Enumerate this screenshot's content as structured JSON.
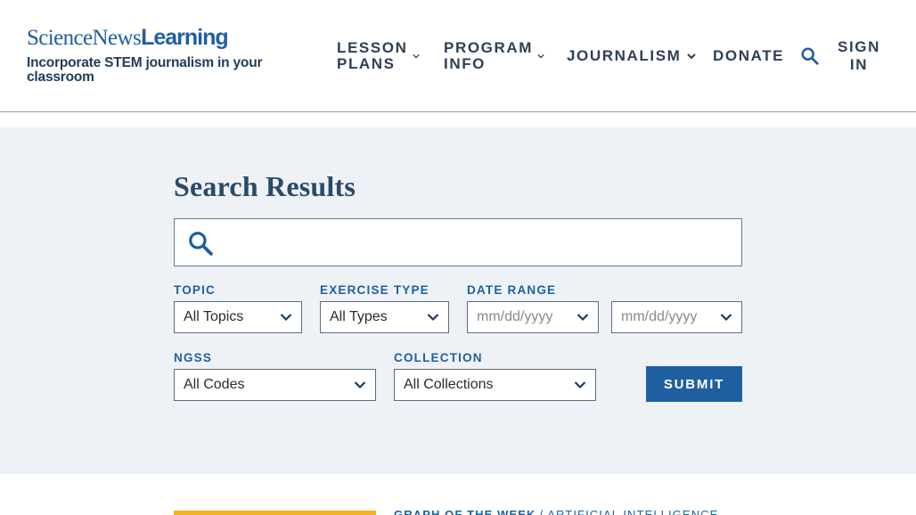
{
  "header": {
    "logo": {
      "science_news": "ScienceNews",
      "learning": "Learning"
    },
    "tagline": "Incorporate STEM journalism in your classroom",
    "nav": {
      "lesson_plans": "LESSON PLANS",
      "program_info": "PROGRAM INFO",
      "journalism": "JOURNALISM",
      "donate": "DONATE",
      "sign_in": "SIGN IN"
    },
    "icons": [
      "search-icon",
      "chevron-down-icon"
    ]
  },
  "search": {
    "title": "Search Results",
    "query": "",
    "filters": {
      "topic": {
        "label": "TOPIC",
        "value": "All Topics"
      },
      "exercise_type": {
        "label": "EXERCISE TYPE",
        "value": "All Types"
      },
      "date_range": {
        "label": "DATE RANGE",
        "from_placeholder": "mm/dd/yyyy",
        "to_placeholder": "mm/dd/yyyy"
      },
      "ngss": {
        "label": "NGSS",
        "value": "All Codes"
      },
      "collection": {
        "label": "COLLECTION",
        "value": "All Collections"
      }
    },
    "submit_label": "SUBMIT"
  },
  "results": [
    {
      "category": "GRAPH OF THE WEEK",
      "topic": "ARTIFICIAL INTELLIGENCE"
    }
  ],
  "colors": {
    "brand_blue": "#1f5fa0",
    "panel_bg": "#eef2f6",
    "thumb_accent": "#f4b323"
  }
}
